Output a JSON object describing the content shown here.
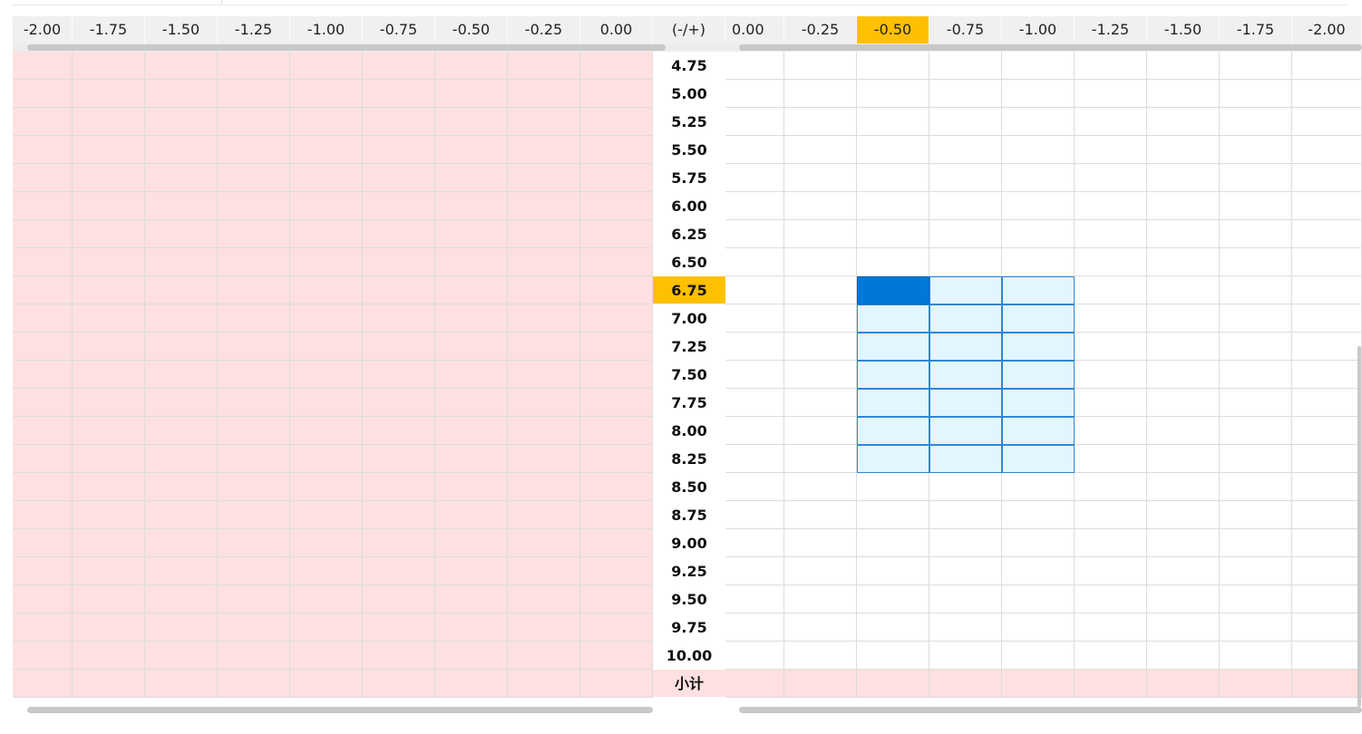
{
  "left_columns": [
    "-2.00",
    "-1.75",
    "-1.50",
    "-1.25",
    "-1.00",
    "-0.75",
    "-0.50",
    "-0.25",
    "0.00"
  ],
  "center_header": "(-/+)",
  "right_columns": [
    "0.00",
    "-0.25",
    "-0.50",
    "-0.75",
    "-1.00",
    "-1.25",
    "-1.50",
    "-1.75",
    "-2.00"
  ],
  "highlighted_right_column": "-0.50",
  "rows": [
    "4.75",
    "5.00",
    "5.25",
    "5.50",
    "5.75",
    "6.00",
    "6.25",
    "6.50",
    "6.75",
    "7.00",
    "7.25",
    "7.50",
    "7.75",
    "8.00",
    "8.25",
    "8.50",
    "8.75",
    "9.00",
    "9.25",
    "9.50",
    "9.75",
    "10.00"
  ],
  "highlighted_row": "6.75",
  "subtotal_label": "小计",
  "selection": {
    "start_row": "6.75",
    "end_row": "8.25",
    "start_col": "-0.50",
    "end_col": "-1.00",
    "active_cell": {
      "row": "6.75",
      "col": "-0.50"
    }
  },
  "colors": {
    "highlight": "#ffc000",
    "left_panel_fill": "#ffe0e0",
    "selection_fill": "#e3f5ff",
    "selection_border": "#2f86d6",
    "active_cell": "#0078d7",
    "header_bg": "#f0f0f0"
  }
}
